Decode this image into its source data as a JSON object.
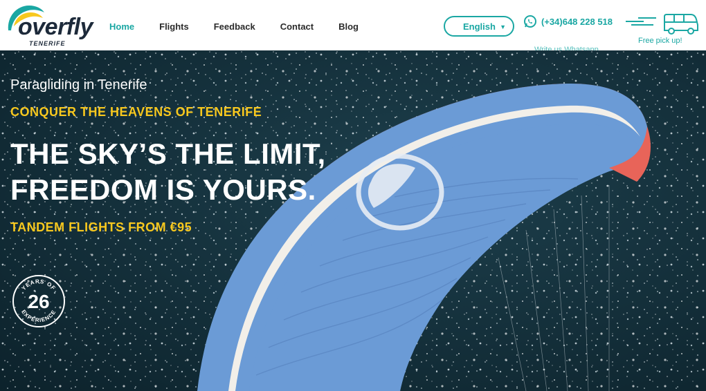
{
  "brand": {
    "name": "overfly",
    "subtitle": "TENERIFE"
  },
  "nav": {
    "items": [
      {
        "label": "Home",
        "active": true
      },
      {
        "label": "Flights",
        "active": false
      },
      {
        "label": "Feedback",
        "active": false
      },
      {
        "label": "Contact",
        "active": false
      },
      {
        "label": "Blog",
        "active": false
      }
    ]
  },
  "language": {
    "selected": "English"
  },
  "contact": {
    "phone": "(+34)648 228 518",
    "whatsapp_hint": "Write us Whatsapp"
  },
  "pickup": {
    "label": "Free pick up!"
  },
  "hero": {
    "kicker": "Paragliding in Tenerife",
    "tagline": "CONQUER THE HEAVENS OF TENERIFE",
    "title_line1": "THE SKY’S THE LIMIT,",
    "title_line2": "FREEDOM IS YOURS.",
    "price": "TANDEM FLIGHTS FROM €95"
  },
  "badge": {
    "number": "26",
    "top_text": "YEARS OF",
    "bottom_text": "EXPERIENCE"
  },
  "colors": {
    "accent": "#1aa7a3",
    "yellow": "#f8c81e",
    "text_dark": "#2b2b2b",
    "sea": "#0f2a36",
    "wing_red": "#e86459",
    "wing_blue": "#6b9bd6"
  },
  "icons": {
    "whatsapp": "whatsapp-icon",
    "van": "van-icon",
    "caret": "chevron-down-icon"
  }
}
